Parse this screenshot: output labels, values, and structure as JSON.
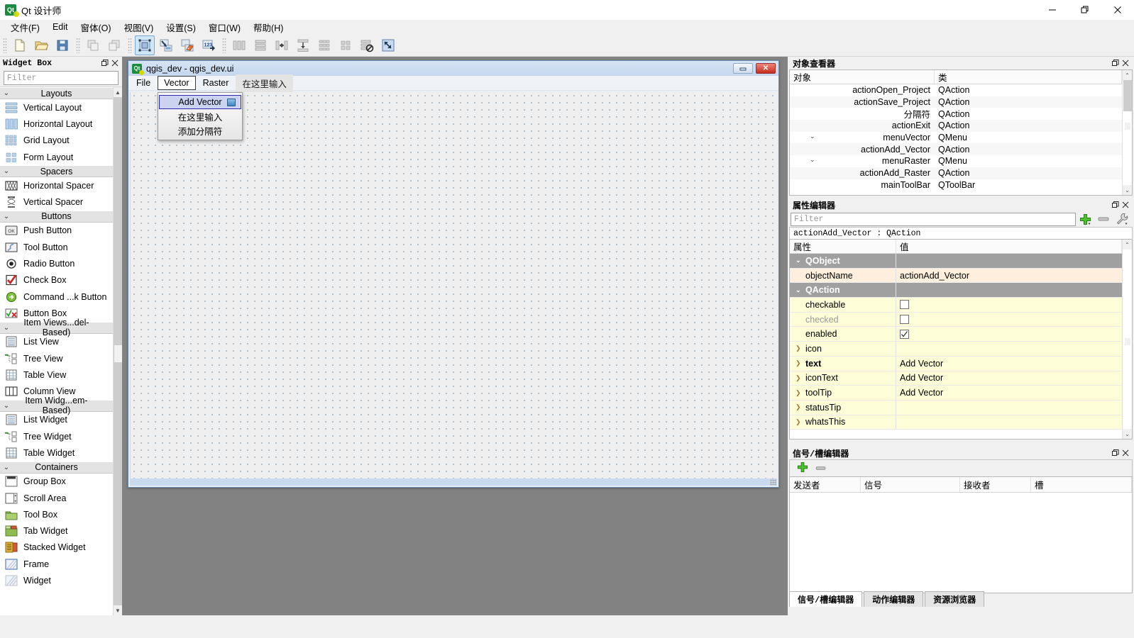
{
  "window": {
    "app_title": "Qt 设计师",
    "app_icon": "qt-designer-icon",
    "minimize": "—",
    "maximize": "❐",
    "close": "✕"
  },
  "menubar": {
    "items": [
      {
        "label": "文件(F)",
        "name": "menu-file"
      },
      {
        "label": "Edit",
        "name": "menu-edit"
      },
      {
        "label": "窗体(O)",
        "name": "menu-form"
      },
      {
        "label": "视图(V)",
        "name": "menu-view"
      },
      {
        "label": "设置(S)",
        "name": "menu-settings"
      },
      {
        "label": "窗口(W)",
        "name": "menu-window"
      },
      {
        "label": "帮助(H)",
        "name": "menu-help"
      }
    ]
  },
  "toolbar": {
    "groups": [
      {
        "buttons": [
          {
            "name": "new-form-button",
            "icon": "new-document-icon",
            "active": false
          },
          {
            "name": "open-form-button",
            "icon": "open-folder-icon",
            "active": false
          },
          {
            "name": "save-form-button",
            "icon": "save-disk-icon",
            "active": false
          }
        ]
      },
      {
        "buttons": [
          {
            "name": "undo-button",
            "icon": "undo-icon",
            "active": false
          },
          {
            "name": "redo-button",
            "icon": "redo-icon",
            "active": false
          }
        ]
      },
      {
        "buttons": [
          {
            "name": "edit-widgets-button",
            "icon": "edit-widgets-icon",
            "active": true
          },
          {
            "name": "edit-signals-slots-button",
            "icon": "signals-slots-icon",
            "active": false
          },
          {
            "name": "edit-buddies-button",
            "icon": "buddies-icon",
            "active": false
          },
          {
            "name": "edit-tab-order-button",
            "icon": "tab-order-icon",
            "active": false
          }
        ]
      },
      {
        "buttons": [
          {
            "name": "layout-horizontally-button",
            "icon": "layout-horizontal-icon",
            "active": false
          },
          {
            "name": "layout-vertically-button",
            "icon": "layout-vertical-icon",
            "active": false
          },
          {
            "name": "layout-splitter-horizontal-button",
            "icon": "splitter-horizontal-icon",
            "active": false
          },
          {
            "name": "layout-splitter-vertical-button",
            "icon": "splitter-vertical-icon",
            "active": false
          },
          {
            "name": "layout-grid-button",
            "icon": "layout-grid-icon",
            "active": false
          },
          {
            "name": "layout-form-button",
            "icon": "layout-form-icon",
            "active": false
          },
          {
            "name": "break-layout-button",
            "icon": "break-layout-icon",
            "active": false
          },
          {
            "name": "adjust-size-button",
            "icon": "adjust-size-icon",
            "active": false
          }
        ]
      }
    ]
  },
  "widget_box": {
    "title": "Widget Box",
    "float_icon": "restore-icon",
    "close_icon": "close-icon",
    "filter_placeholder": "Filter",
    "sections": [
      {
        "name": "Layouts",
        "expanded": true,
        "items": [
          {
            "label": "Vertical Layout",
            "icon": "vertical-layout-icon"
          },
          {
            "label": "Horizontal Layout",
            "icon": "horizontal-layout-icon"
          },
          {
            "label": "Grid Layout",
            "icon": "grid-layout-icon"
          },
          {
            "label": "Form Layout",
            "icon": "form-layout-icon"
          }
        ]
      },
      {
        "name": "Spacers",
        "expanded": true,
        "items": [
          {
            "label": "Horizontal Spacer",
            "icon": "horizontal-spacer-icon"
          },
          {
            "label": "Vertical Spacer",
            "icon": "vertical-spacer-icon"
          }
        ]
      },
      {
        "name": "Buttons",
        "expanded": true,
        "items": [
          {
            "label": "Push Button",
            "icon": "push-button-icon"
          },
          {
            "label": "Tool Button",
            "icon": "tool-button-icon"
          },
          {
            "label": "Radio Button",
            "icon": "radio-button-icon"
          },
          {
            "label": "Check Box",
            "icon": "check-box-icon"
          },
          {
            "label": "Command ...k Button",
            "icon": "command-link-button-icon"
          },
          {
            "label": "Button Box",
            "icon": "button-box-icon"
          }
        ]
      },
      {
        "name": "Item Views...del-Based)",
        "expanded": true,
        "items": [
          {
            "label": "List View",
            "icon": "list-view-icon"
          },
          {
            "label": "Tree View",
            "icon": "tree-view-icon"
          },
          {
            "label": "Table View",
            "icon": "table-view-icon"
          },
          {
            "label": "Column View",
            "icon": "column-view-icon"
          }
        ]
      },
      {
        "name": "Item Widg...em-Based)",
        "expanded": true,
        "items": [
          {
            "label": "List Widget",
            "icon": "list-widget-icon"
          },
          {
            "label": "Tree Widget",
            "icon": "tree-widget-icon"
          },
          {
            "label": "Table Widget",
            "icon": "table-widget-icon"
          }
        ]
      },
      {
        "name": "Containers",
        "expanded": true,
        "items": [
          {
            "label": "Group Box",
            "icon": "group-box-icon"
          },
          {
            "label": "Scroll Area",
            "icon": "scroll-area-icon"
          },
          {
            "label": "Tool Box",
            "icon": "tool-box-icon"
          },
          {
            "label": "Tab Widget",
            "icon": "tab-widget-icon"
          },
          {
            "label": "Stacked Widget",
            "icon": "stacked-widget-icon"
          },
          {
            "label": "Frame",
            "icon": "frame-icon"
          },
          {
            "label": "Widget",
            "icon": "widget-icon"
          }
        ]
      }
    ]
  },
  "form_window": {
    "title": "qgis_dev - qgis_dev.ui",
    "icon": "qt-form-icon",
    "minimize_label": "—",
    "close_label": "✕",
    "menubar": [
      {
        "label": "File",
        "state": "normal"
      },
      {
        "label": "Vector",
        "state": "selected"
      },
      {
        "label": "Raster",
        "state": "normal"
      },
      {
        "label": "在这里输入",
        "state": "placeholder"
      }
    ],
    "open_menu": {
      "items": [
        {
          "label": "Add Vector",
          "highlighted": true,
          "badge": "action-icon"
        },
        {
          "label": "在这里输入",
          "highlighted": false,
          "badge": null
        },
        {
          "label": "添加分隔符",
          "highlighted": false,
          "badge": null
        }
      ]
    }
  },
  "object_inspector": {
    "title": "对象查看器",
    "float_icon": "restore-icon",
    "close_icon": "close-icon",
    "columns": [
      "对象",
      "类"
    ],
    "rows": [
      {
        "object": "actionOpen_Project",
        "class": "QAction",
        "indent": 3,
        "expander": null
      },
      {
        "object": "actionSave_Project",
        "class": "QAction",
        "indent": 3,
        "expander": null
      },
      {
        "object": "分隔符",
        "class": "QAction",
        "indent": 3,
        "expander": null
      },
      {
        "object": "actionExit",
        "class": "QAction",
        "indent": 3,
        "expander": null
      },
      {
        "object": "menuVector",
        "class": "QMenu",
        "indent": 2,
        "expander": "v"
      },
      {
        "object": "actionAdd_Vector",
        "class": "QAction",
        "indent": 3,
        "expander": null
      },
      {
        "object": "menuRaster",
        "class": "QMenu",
        "indent": 2,
        "expander": "v"
      },
      {
        "object": "actionAdd_Raster",
        "class": "QAction",
        "indent": 3,
        "expander": null
      },
      {
        "object": "mainToolBar",
        "class": "QToolBar",
        "indent": 1,
        "expander": null
      }
    ]
  },
  "property_editor": {
    "title": "属性编辑器",
    "float_icon": "restore-icon",
    "close_icon": "close-icon",
    "filter_placeholder": "Filter",
    "add_icon": "add-plus-icon",
    "remove_icon": "remove-minus-icon",
    "configure_icon": "wrench-icon",
    "object_line": "actionAdd_Vector : QAction",
    "columns": [
      "属性",
      "值"
    ],
    "rows": [
      {
        "kind": "group",
        "name": "QObject",
        "value": "",
        "expander": "v"
      },
      {
        "kind": "prop-name-hl",
        "name": "objectName",
        "value": "actionAdd_Vector",
        "expander": null
      },
      {
        "kind": "group",
        "name": "QAction",
        "value": "",
        "expander": "v"
      },
      {
        "kind": "prop-check",
        "name": "checkable",
        "value": "",
        "checked": false,
        "expander": null
      },
      {
        "kind": "prop-check-disabled",
        "name": "checked",
        "value": "",
        "checked": false,
        "expander": null
      },
      {
        "kind": "prop-check",
        "name": "enabled",
        "value": "",
        "checked": true,
        "expander": null
      },
      {
        "kind": "prop",
        "name": "icon",
        "value": "",
        "expander": ">"
      },
      {
        "kind": "prop-bold",
        "name": "text",
        "value": "Add Vector",
        "expander": ">"
      },
      {
        "kind": "prop",
        "name": "iconText",
        "value": "Add Vector",
        "expander": ">"
      },
      {
        "kind": "prop",
        "name": "toolTip",
        "value": "Add Vector",
        "expander": ">"
      },
      {
        "kind": "prop",
        "name": "statusTip",
        "value": "",
        "expander": ">"
      },
      {
        "kind": "prop",
        "name": "whatsThis",
        "value": "",
        "expander": ">"
      }
    ]
  },
  "signal_slot_editor": {
    "title": "信号/槽编辑器",
    "float_icon": "restore-icon",
    "close_icon": "close-icon",
    "add_icon": "add-plus-icon",
    "remove_icon": "remove-minus-icon",
    "columns": [
      "发送者",
      "信号",
      "接收者",
      "槽"
    ],
    "rows": [],
    "tabs": [
      {
        "label": "信号/槽编辑器",
        "selected": true
      },
      {
        "label": "动作编辑器",
        "selected": false
      },
      {
        "label": "资源浏览器",
        "selected": false
      }
    ]
  },
  "colors": {
    "accent": "#cfe6fa",
    "canvas_bg": "#828282",
    "form_title": "#c4d7ee",
    "group_row": "#a0a0a0",
    "prop_yellow": "#fdfdd8",
    "prop_name_hl": "#fdeedd",
    "close_red": "#c52d1c"
  }
}
